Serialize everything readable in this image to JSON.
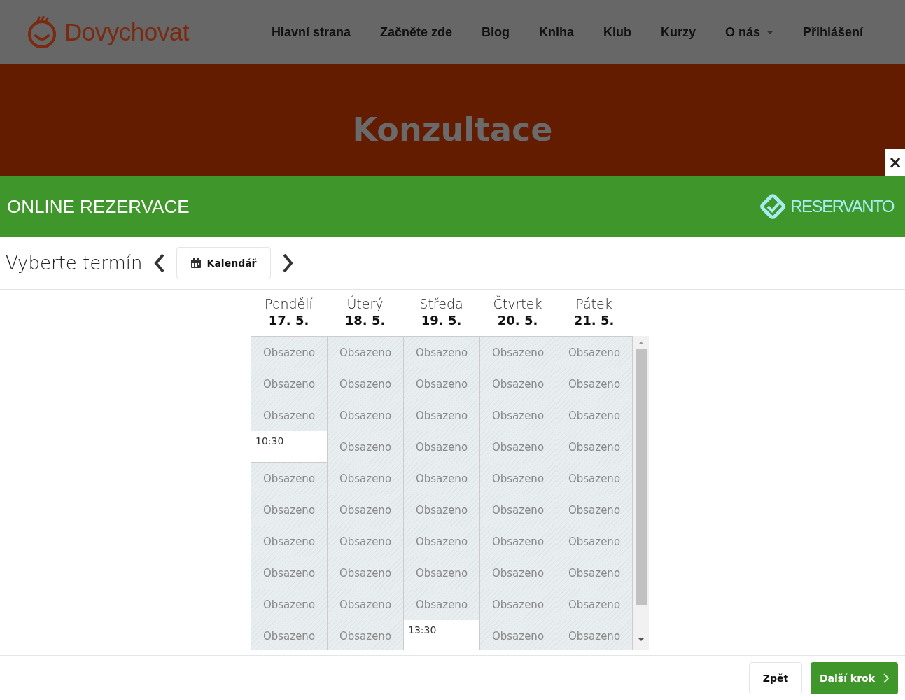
{
  "site": {
    "logo": "Dovychovat",
    "nav": [
      {
        "label": "Hlavní strana",
        "dropdown": false
      },
      {
        "label": "Začněte zde",
        "dropdown": false
      },
      {
        "label": "Blog",
        "dropdown": false
      },
      {
        "label": "Kniha",
        "dropdown": false
      },
      {
        "label": "Klub",
        "dropdown": false
      },
      {
        "label": "Kurzy",
        "dropdown": false
      },
      {
        "label": "O nás",
        "dropdown": true
      },
      {
        "label": "Přihlášení",
        "dropdown": false
      }
    ],
    "hero": {
      "title": "Konzultace"
    }
  },
  "modal": {
    "close": "×",
    "title": "ONLINE REZERVACE",
    "brand": "RESERVANTO",
    "toolbar": {
      "heading": "Vyberte termín",
      "calendar_button": "Kalendář"
    },
    "days": [
      {
        "name": "Pondělí",
        "date": "17. 5.",
        "slots": [
          {
            "kind": "busy",
            "label": "Obsazeno"
          },
          {
            "kind": "busy",
            "label": "Obsazeno"
          },
          {
            "kind": "busy",
            "label": "Obsazeno"
          },
          {
            "kind": "free",
            "label": "10:30"
          },
          {
            "kind": "busy",
            "label": "Obsazeno"
          },
          {
            "kind": "busy",
            "label": "Obsazeno"
          },
          {
            "kind": "busy",
            "label": "Obsazeno"
          },
          {
            "kind": "busy",
            "label": "Obsazeno"
          },
          {
            "kind": "busy",
            "label": "Obsazeno"
          },
          {
            "kind": "busy",
            "label": "Obsazeno"
          }
        ]
      },
      {
        "name": "Úterý",
        "date": "18. 5.",
        "slots": [
          {
            "kind": "busy",
            "label": "Obsazeno"
          },
          {
            "kind": "busy",
            "label": "Obsazeno"
          },
          {
            "kind": "busy",
            "label": "Obsazeno"
          },
          {
            "kind": "busy",
            "label": "Obsazeno"
          },
          {
            "kind": "busy",
            "label": "Obsazeno"
          },
          {
            "kind": "busy",
            "label": "Obsazeno"
          },
          {
            "kind": "busy",
            "label": "Obsazeno"
          },
          {
            "kind": "busy",
            "label": "Obsazeno"
          },
          {
            "kind": "busy",
            "label": "Obsazeno"
          },
          {
            "kind": "busy",
            "label": "Obsazeno"
          }
        ]
      },
      {
        "name": "Středa",
        "date": "19. 5.",
        "slots": [
          {
            "kind": "busy",
            "label": "Obsazeno"
          },
          {
            "kind": "busy",
            "label": "Obsazeno"
          },
          {
            "kind": "busy",
            "label": "Obsazeno"
          },
          {
            "kind": "busy",
            "label": "Obsazeno"
          },
          {
            "kind": "busy",
            "label": "Obsazeno"
          },
          {
            "kind": "busy",
            "label": "Obsazeno"
          },
          {
            "kind": "busy",
            "label": "Obsazeno"
          },
          {
            "kind": "busy",
            "label": "Obsazeno"
          },
          {
            "kind": "busy",
            "label": "Obsazeno"
          },
          {
            "kind": "free",
            "label": "13:30"
          }
        ]
      },
      {
        "name": "Čtvrtek",
        "date": "20. 5.",
        "slots": [
          {
            "kind": "busy",
            "label": "Obsazeno"
          },
          {
            "kind": "busy",
            "label": "Obsazeno"
          },
          {
            "kind": "busy",
            "label": "Obsazeno"
          },
          {
            "kind": "busy",
            "label": "Obsazeno"
          },
          {
            "kind": "busy",
            "label": "Obsazeno"
          },
          {
            "kind": "busy",
            "label": "Obsazeno"
          },
          {
            "kind": "busy",
            "label": "Obsazeno"
          },
          {
            "kind": "busy",
            "label": "Obsazeno"
          },
          {
            "kind": "busy",
            "label": "Obsazeno"
          },
          {
            "kind": "busy",
            "label": "Obsazeno"
          }
        ]
      },
      {
        "name": "Pátek",
        "date": "21. 5.",
        "slots": [
          {
            "kind": "busy",
            "label": "Obsazeno"
          },
          {
            "kind": "busy",
            "label": "Obsazeno"
          },
          {
            "kind": "busy",
            "label": "Obsazeno"
          },
          {
            "kind": "busy",
            "label": "Obsazeno"
          },
          {
            "kind": "busy",
            "label": "Obsazeno"
          },
          {
            "kind": "busy",
            "label": "Obsazeno"
          },
          {
            "kind": "busy",
            "label": "Obsazeno"
          },
          {
            "kind": "busy",
            "label": "Obsazeno"
          },
          {
            "kind": "busy",
            "label": "Obsazeno"
          },
          {
            "kind": "busy",
            "label": "Obsazeno"
          }
        ]
      }
    ],
    "footer": {
      "back": "Zpět",
      "next": "Další krok"
    }
  }
}
